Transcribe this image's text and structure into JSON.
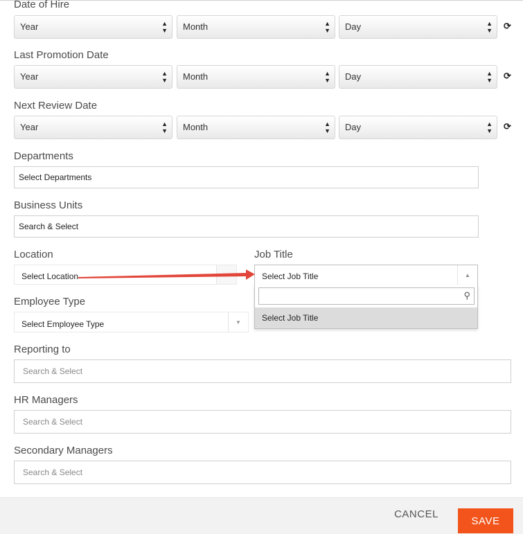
{
  "form": {
    "date_of_hire": {
      "label": "Date of Hire",
      "year": "Year",
      "month": "Month",
      "day": "Day"
    },
    "last_promotion": {
      "label": "Last Promotion Date",
      "year": "Year",
      "month": "Month",
      "day": "Day"
    },
    "next_review": {
      "label": "Next Review Date",
      "year": "Year",
      "month": "Month",
      "day": "Day"
    },
    "departments": {
      "label": "Departments",
      "value": "Select Departments"
    },
    "business_units": {
      "label": "Business Units",
      "value": "Search & Select"
    },
    "location": {
      "label": "Location",
      "value": "Select Location"
    },
    "job_title": {
      "label": "Job Title",
      "value": "Select Job Title",
      "search_value": "",
      "options": [
        "Select Job Title"
      ]
    },
    "employee_type": {
      "label": "Employee Type",
      "value": "Select Employee Type"
    },
    "reporting_to": {
      "label": "Reporting to",
      "placeholder": "Search & Select"
    },
    "hr_managers": {
      "label": "HR Managers",
      "placeholder": "Search & Select"
    },
    "secondary_managers": {
      "label": "Secondary Managers",
      "placeholder": "Search & Select"
    }
  },
  "icons": {
    "reset": "refresh-icon",
    "dropdown": "double-chevron-icon",
    "search": "search-icon"
  },
  "footer": {
    "cancel_label": "CANCEL",
    "save_label": "SAVE"
  },
  "colors": {
    "save": "#f2541b",
    "arrow": "#e2463a"
  }
}
